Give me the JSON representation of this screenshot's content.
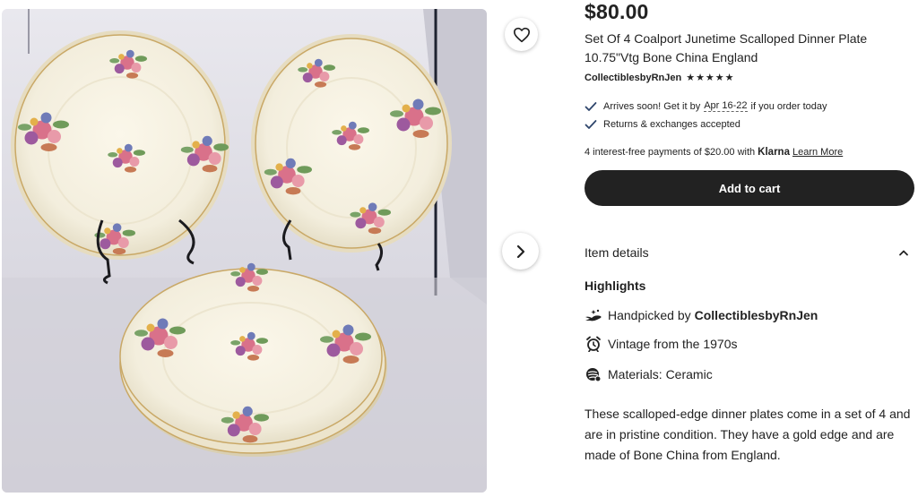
{
  "product": {
    "price": "$80.00",
    "title": "Set Of 4 Coalport Junetime Scalloped Dinner Plate 10.75\"Vtg Bone China England",
    "shop_name": "CollectiblesbyRnJen",
    "rating_stars": "★★★★★",
    "rating_value": 5
  },
  "shipping": {
    "arrives_prefix": "Arrives soon! Get it by",
    "arrives_date": "Apr 16-22",
    "arrives_suffix": "if you order today",
    "returns": "Returns & exchanges accepted"
  },
  "payment": {
    "klarna_prefix": "4 interest-free payments of $20.00 with",
    "klarna_brand": "Klarna",
    "learn_more": "Learn More"
  },
  "actions": {
    "add_to_cart": "Add to cart"
  },
  "details": {
    "section_label": "Item details",
    "highlights_label": "Highlights",
    "handpicked_prefix": "Handpicked by",
    "handpicked_shop": "CollectiblesbyRnJen",
    "vintage": "Vintage from the 1970s",
    "materials": "Materials: Ceramic",
    "description": "These scalloped-edge dinner plates come in a set of 4 and are in pristine condition. They have a gold edge and are made of Bone China from England."
  },
  "icons": {
    "favorite": "heart-icon",
    "next": "chevron-right-icon",
    "check": "check-icon",
    "collapse": "chevron-up-icon",
    "handpicked": "hand-icon",
    "vintage": "alarm-clock-icon",
    "materials": "materials-icon"
  },
  "colors": {
    "accent_check": "#2f466c",
    "button_bg": "#222222",
    "text": "#222222"
  }
}
